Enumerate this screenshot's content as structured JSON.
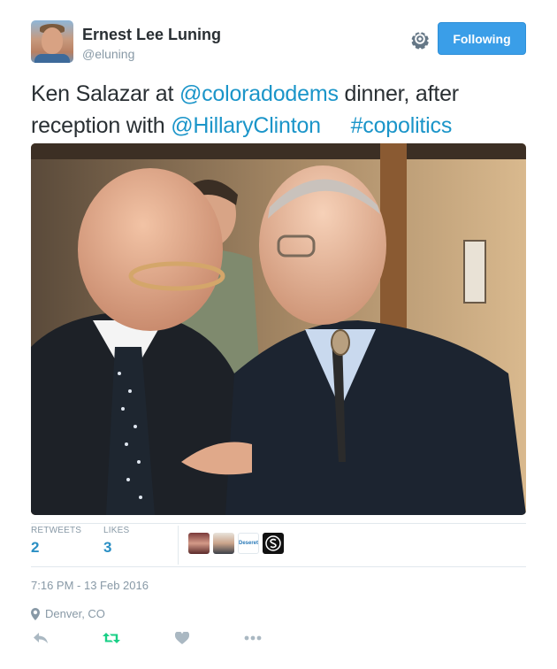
{
  "author": {
    "name": "Ernest Lee Luning",
    "handle": "@eluning"
  },
  "follow_button": {
    "label": "Following"
  },
  "tweet": {
    "parts": [
      {
        "text": "Ken Salazar at ",
        "link": false
      },
      {
        "text": "@coloradodems",
        "link": true
      },
      {
        "text": " dinner, after reception with ",
        "link": false
      },
      {
        "text": "@HillaryClinton",
        "link": true
      },
      {
        "text": "     ",
        "link": false
      },
      {
        "text": "#copolitics",
        "link": true
      }
    ]
  },
  "photo": {
    "alt": ""
  },
  "stats": {
    "retweets_label": "RETWEETS",
    "retweets_count": "2",
    "likes_label": "LIKES",
    "likes_count": "3",
    "liker_avatar_names": [
      "liker-avatar-1",
      "liker-avatar-2",
      "liker-avatar-deseret",
      "liker-avatar-s"
    ],
    "liker_logo_text": "Deseret"
  },
  "meta": {
    "timestamp": "7:16 PM - 13 Feb 2016",
    "location": "Denver, CO"
  },
  "icons": {
    "reply": "reply-icon",
    "retweet": "retweet-icon",
    "like": "heart-icon",
    "more": "more-icon",
    "settings": "gear-icon",
    "location": "location-pin-icon"
  },
  "colors": {
    "accent": "#1b95c9",
    "follow_button": "#3a9ee8",
    "retweet_active": "#19cf86",
    "muted": "#8899a6"
  }
}
